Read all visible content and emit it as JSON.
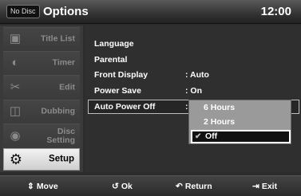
{
  "header": {
    "badge": "No Disc",
    "title": "Options",
    "clock": "12:00"
  },
  "sidebar": {
    "items": [
      {
        "label": "Title List",
        "icon": "title-list-icon",
        "active": false
      },
      {
        "label": "Timer",
        "icon": "timer-icon",
        "active": false
      },
      {
        "label": "Edit",
        "icon": "edit-icon",
        "active": false
      },
      {
        "label": "Dubbing",
        "icon": "dubbing-icon",
        "active": false
      },
      {
        "label": "Disc\nSetting",
        "label_line1": "Disc",
        "label_line2": "Setting",
        "icon": "disc-setting-icon",
        "active": false
      },
      {
        "label": "Setup",
        "icon": "setup-gear-icon",
        "active": true
      }
    ]
  },
  "menu": {
    "rows": [
      {
        "label": "Language",
        "value": ""
      },
      {
        "label": "Parental",
        "value": ""
      },
      {
        "label": "Front Display",
        "value": ": Auto"
      },
      {
        "label": "Power Save",
        "value": ": On"
      },
      {
        "label": "Auto Power Off",
        "value": ":"
      }
    ],
    "dropdown": {
      "options": [
        "6 Hours",
        "2 Hours",
        "Off"
      ],
      "selected": "Off"
    }
  },
  "footer": {
    "move": "Move",
    "ok": "Ok",
    "return": "Return",
    "exit": "Exit"
  }
}
